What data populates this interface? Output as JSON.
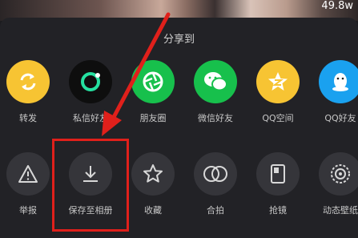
{
  "header": {
    "counter_text": "49.8w"
  },
  "share_sheet": {
    "title": "分享到",
    "share_targets": [
      {
        "label": "转发",
        "icon": "repost-icon",
        "color": "#f7c433"
      },
      {
        "label": "私信好友",
        "icon": "message-ring-icon",
        "color": "#0e0e0e"
      },
      {
        "label": "朋友圈",
        "icon": "moments-aperture-icon",
        "color": "#17c04c"
      },
      {
        "label": "微信好友",
        "icon": "wechat-icon",
        "color": "#17c04c"
      },
      {
        "label": "QQ空间",
        "icon": "qzone-star-icon",
        "color": "#f7c433"
      },
      {
        "label": "QQ好友",
        "icon": "qq-penguin-icon",
        "color": "#1aa1ef"
      }
    ],
    "actions": [
      {
        "label": "举报",
        "icon": "report-warning-icon"
      },
      {
        "label": "保存至相册",
        "icon": "download-icon"
      },
      {
        "label": "收藏",
        "icon": "star-icon"
      },
      {
        "label": "合拍",
        "icon": "duet-icon"
      },
      {
        "label": "抢镜",
        "icon": "react-camera-icon"
      },
      {
        "label": "动态壁纸",
        "icon": "live-wallpaper-icon"
      }
    ]
  },
  "annotation": {
    "highlight_color": "#e0201b"
  }
}
